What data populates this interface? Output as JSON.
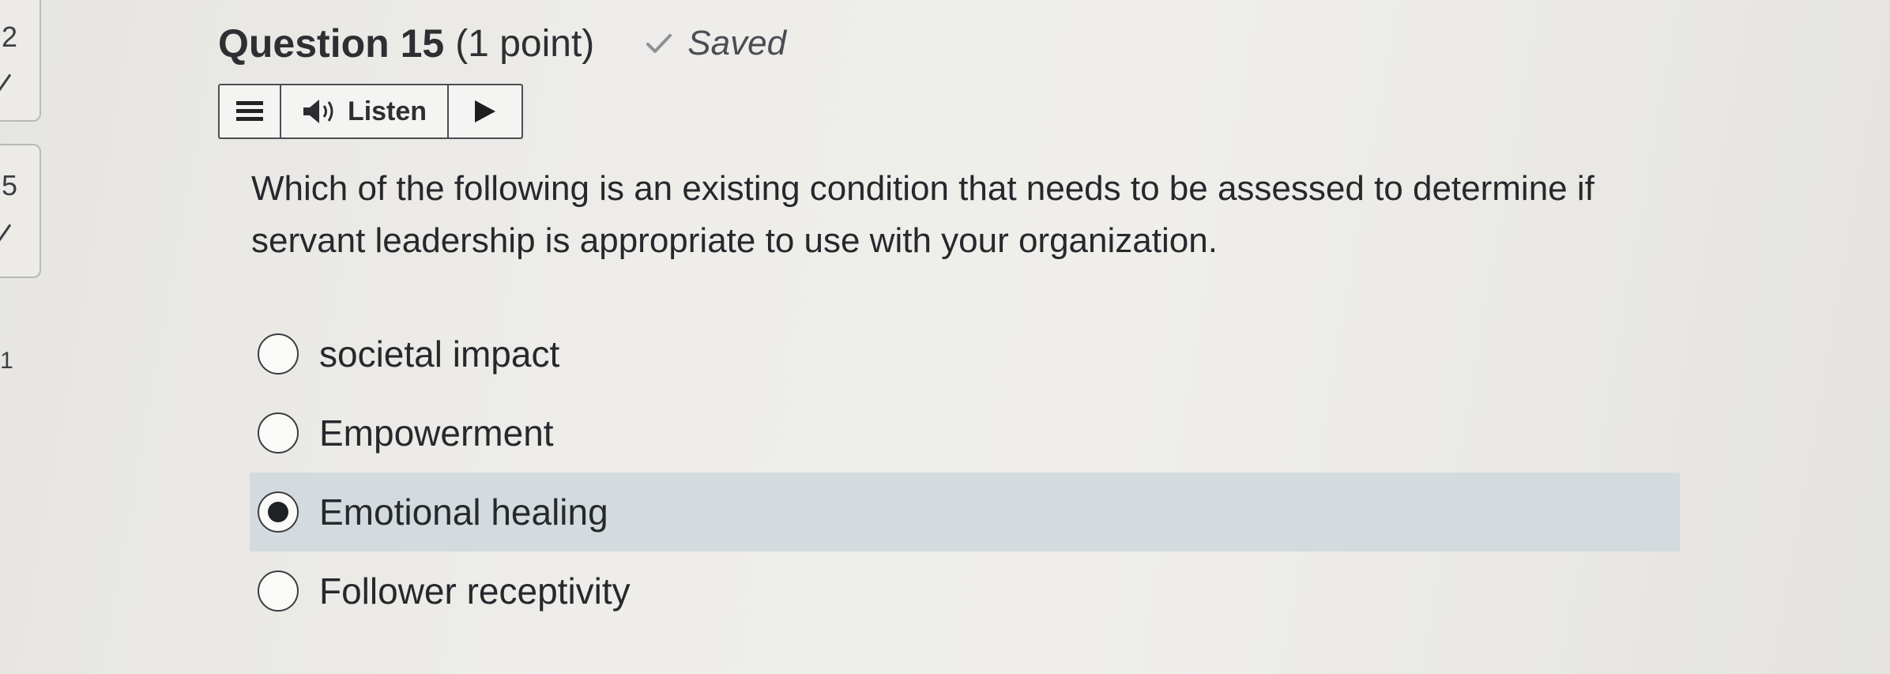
{
  "nav": {
    "items": [
      {
        "number": "2",
        "answered": true
      },
      {
        "number": "5",
        "answered": true
      },
      {
        "number": "1",
        "answered": false
      }
    ]
  },
  "question": {
    "title": "Question 15",
    "points": "(1 point)",
    "status": "Saved",
    "text": "Which of the following is an existing condition that needs to be assessed to determine if servant leadership is appropriate to use with your organization."
  },
  "listen_bar": {
    "menu_icon": "menu-icon",
    "speaker_icon": "speaker-icon",
    "label": "Listen",
    "play_icon": "play-icon"
  },
  "options": [
    {
      "label": "societal impact",
      "selected": false
    },
    {
      "label": "Empowerment",
      "selected": false
    },
    {
      "label": "Emotional healing",
      "selected": true
    },
    {
      "label": "Follower receptivity",
      "selected": false
    }
  ],
  "colors": {
    "selected_row": "#d4dbde",
    "text": "#26282c"
  }
}
